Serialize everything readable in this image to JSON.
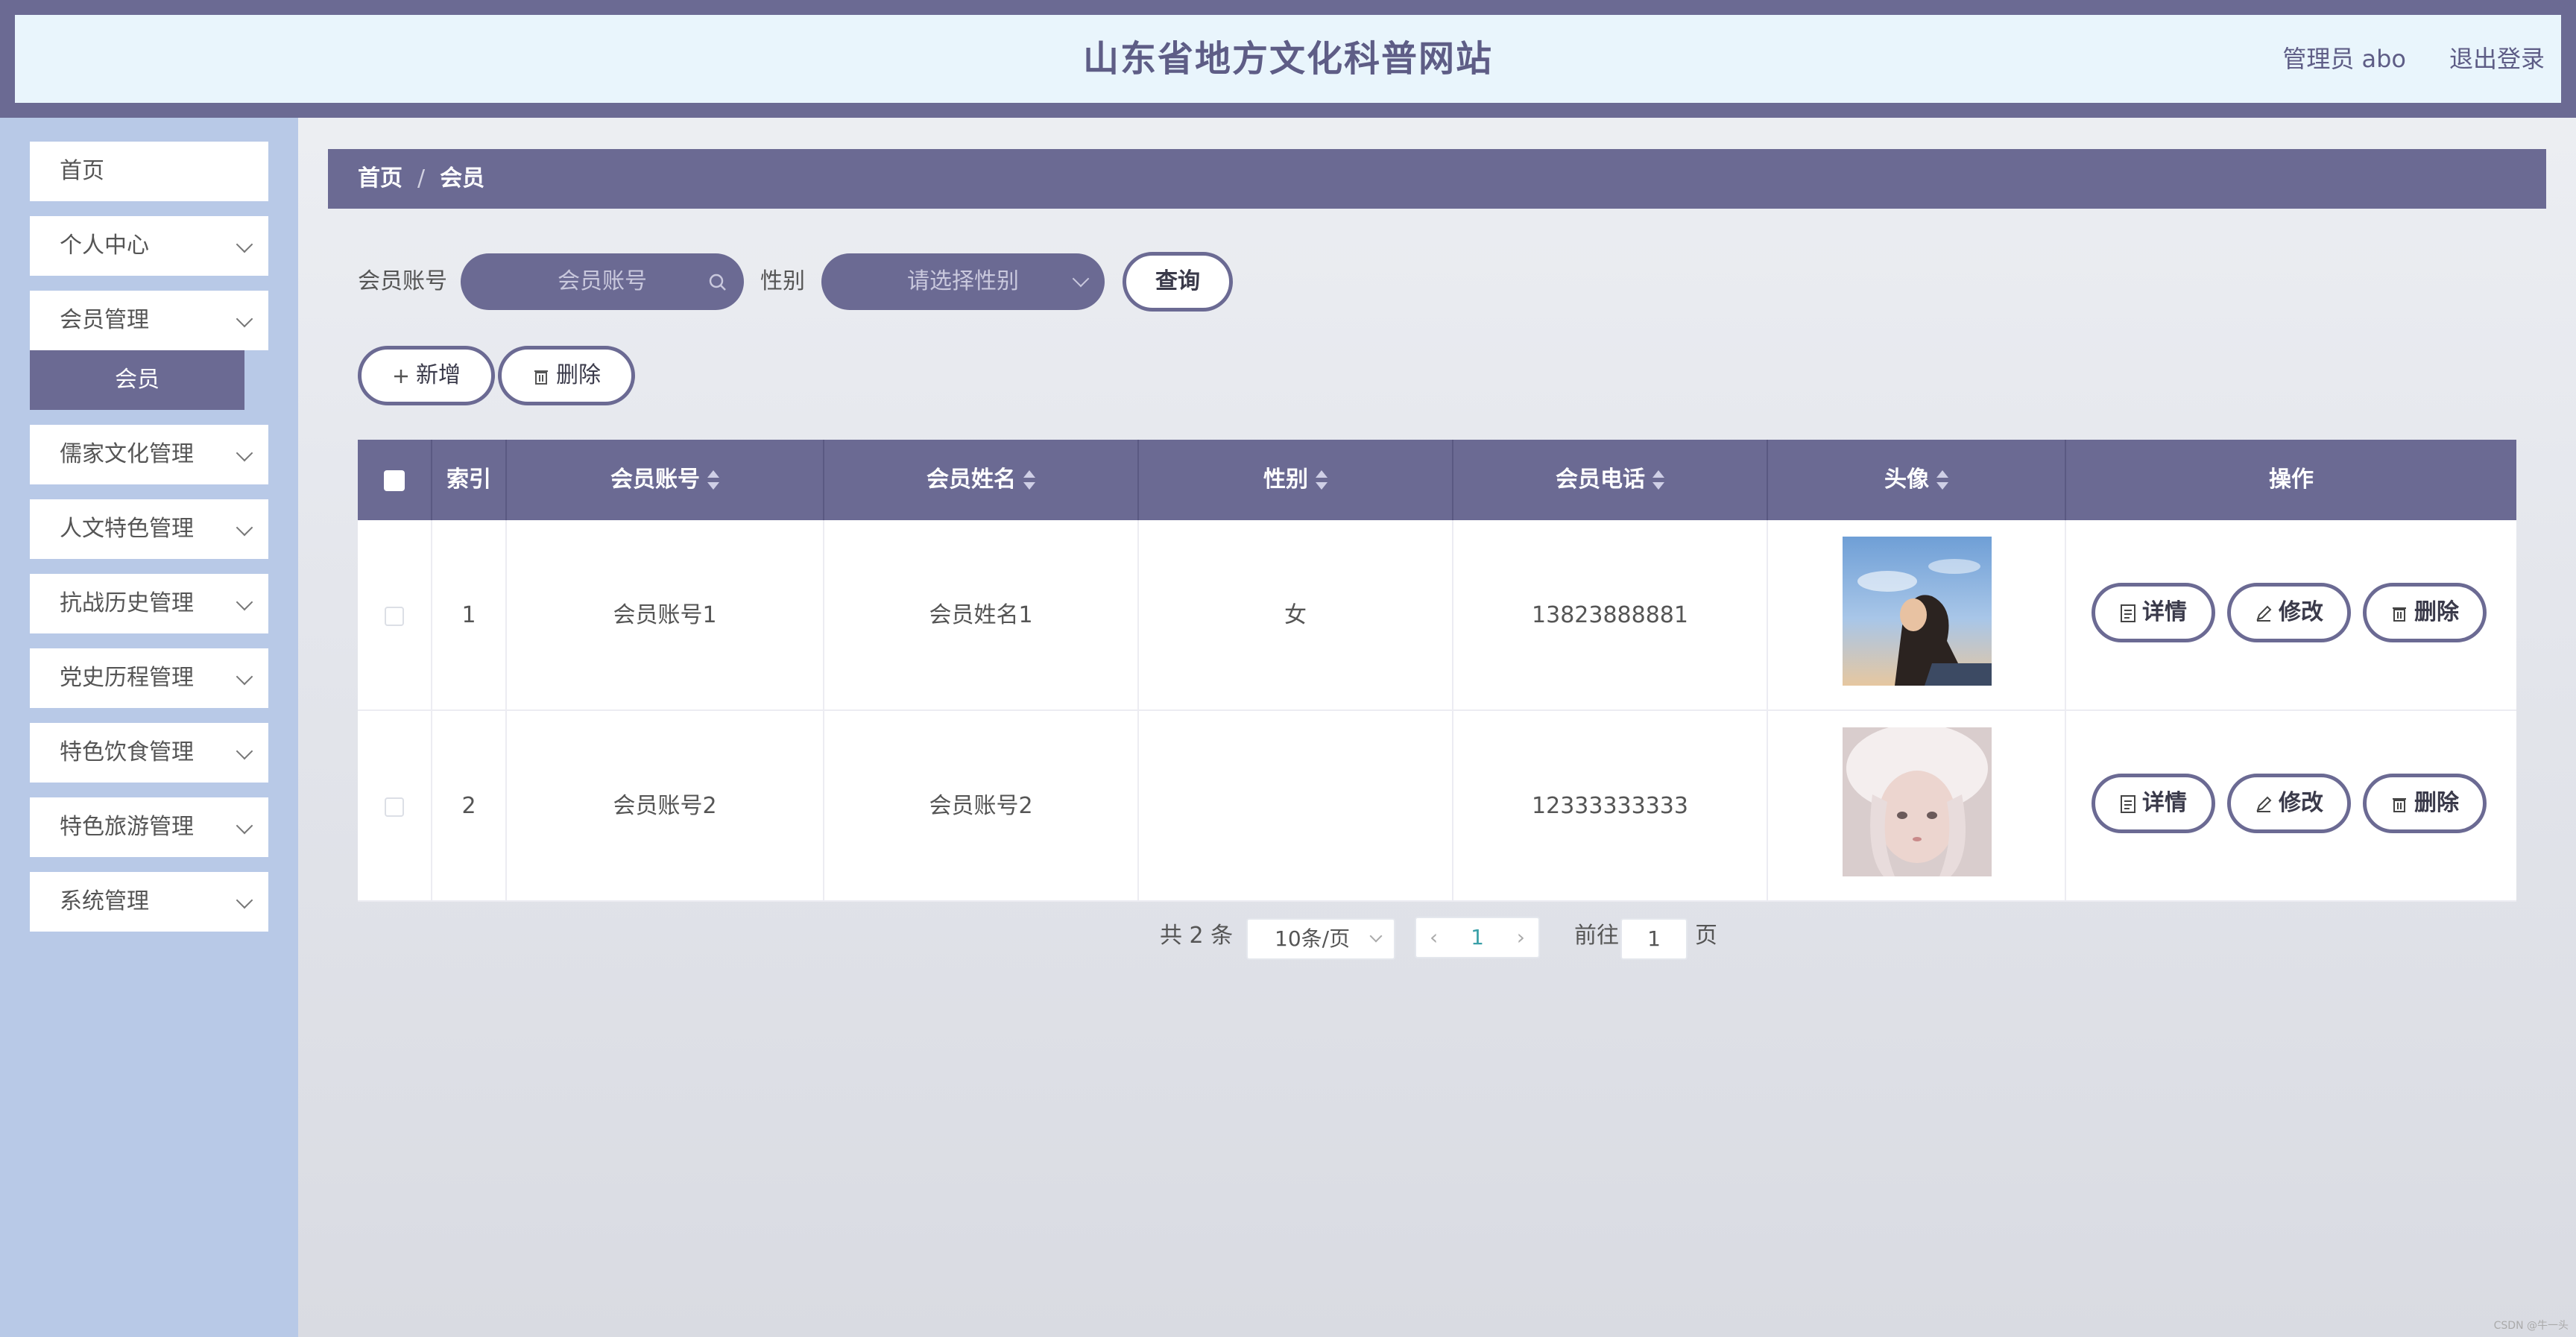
{
  "header": {
    "title": "山东省地方文化科普网站",
    "admin": "管理员 abo",
    "logout": "退出登录"
  },
  "sidebar": {
    "items": [
      {
        "label": "首页"
      },
      {
        "label": "个人中心"
      },
      {
        "label": "会员管理"
      },
      {
        "label": "儒家文化管理"
      },
      {
        "label": "人文特色管理"
      },
      {
        "label": "抗战历史管理"
      },
      {
        "label": "党史历程管理"
      },
      {
        "label": "特色饮食管理"
      },
      {
        "label": "特色旅游管理"
      },
      {
        "label": "系统管理"
      }
    ],
    "sub_active": "会员"
  },
  "breadcrumb": {
    "home": "首页",
    "sep": "/",
    "current": "会员"
  },
  "search": {
    "account_label": "会员账号",
    "account_placeholder": "会员账号",
    "gender_label": "性别",
    "gender_placeholder": "请选择性别",
    "query_button": "查询"
  },
  "actions": {
    "add": "新增",
    "delete": "删除"
  },
  "table": {
    "headers": [
      "索引",
      "会员账号",
      "会员姓名",
      "性别",
      "会员电话",
      "头像",
      "操作"
    ],
    "rows": [
      {
        "index": "1",
        "account": "会员账号1",
        "name": "会员姓名1",
        "gender": "女",
        "phone": "13823888881",
        "avatar": "avatar-1"
      },
      {
        "index": "2",
        "account": "会员账号2",
        "name": "会员账号2",
        "gender": "",
        "phone": "12333333333",
        "avatar": "avatar-2"
      }
    ],
    "op_labels": {
      "detail": "详情",
      "edit": "修改",
      "delete": "删除"
    }
  },
  "pagination": {
    "total": "共 2 条",
    "page_size": "10条/页",
    "current_page": "1",
    "goto_label": "前往",
    "goto_value": "1",
    "page_suffix": "页"
  },
  "watermark": "CSDN @牛一头",
  "colors": {
    "accent": "#6b6a93",
    "sidebar": "#b8c9e7",
    "header_bg": "#e9f5fc"
  }
}
